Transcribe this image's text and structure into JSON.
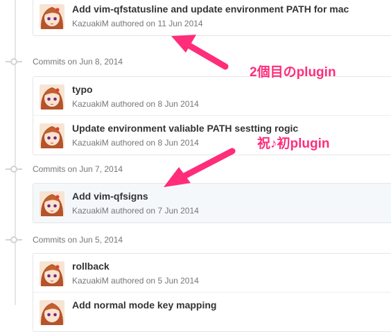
{
  "groups": [
    {
      "heading": "",
      "commits": [
        {
          "title": "Add vim-qfstatusline and update environment PATH for mac",
          "author": "KazuakiM",
          "authored_text": "authored on",
          "date": "11 Jun 2014"
        }
      ]
    },
    {
      "heading": "Commits on Jun 8, 2014",
      "commits": [
        {
          "title": "typo",
          "author": "KazuakiM",
          "authored_text": "authored on",
          "date": "8 Jun 2014"
        },
        {
          "title": "Update environment valiable PATH sestting rogic",
          "author": "KazuakiM",
          "authored_text": "authored on",
          "date": "8 Jun 2014"
        }
      ]
    },
    {
      "heading": "Commits on Jun 7, 2014",
      "commits": [
        {
          "title": "Add vim-qfsigns",
          "author": "KazuakiM",
          "authored_text": "authored on",
          "date": "7 Jun 2014"
        }
      ]
    },
    {
      "heading": "Commits on Jun 5, 2014",
      "commits": [
        {
          "title": "rollback",
          "author": "KazuakiM",
          "authored_text": "authored on",
          "date": "5 Jun 2014"
        },
        {
          "title": "Add normal mode key mapping",
          "author": "",
          "authored_text": "",
          "date": ""
        }
      ]
    }
  ],
  "annotations": {
    "second_plugin": "2個目のplugin",
    "first_plugin": "祝♪初plugin",
    "color": "#ff2d7a"
  },
  "icons": {
    "avatar": "anime-avatar",
    "timeline_dot": "commit-dot-icon",
    "arrow": "pink-arrow-icon"
  }
}
